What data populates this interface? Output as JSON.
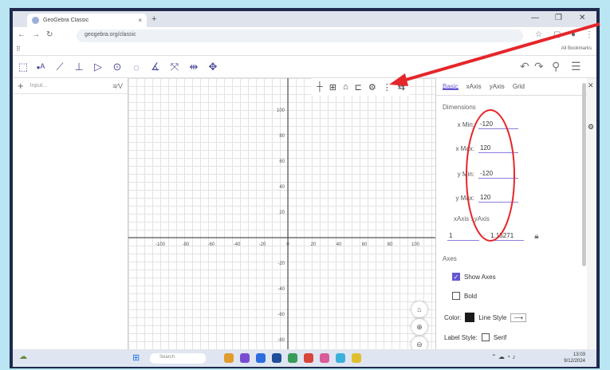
{
  "browser": {
    "tab_title": "GeoGebra Classic",
    "tab_close": "×",
    "new_tab": "+",
    "url": "geogebra.org/classic",
    "all_bookmarks": "All Bookmarks"
  },
  "algebra": {
    "add": "+",
    "input_placeholder": "Input..."
  },
  "graphics": {
    "x_ticks": [
      "-100",
      "-80",
      "-60",
      "-40",
      "-20",
      "0",
      "20",
      "40",
      "60",
      "80",
      "100"
    ],
    "y_ticks": [
      "100",
      "80",
      "60",
      "40",
      "20",
      "-20",
      "-40",
      "-60",
      "-80",
      "-100"
    ]
  },
  "settings": {
    "tabs": [
      "Basic",
      "xAxis",
      "yAxis",
      "Grid"
    ],
    "dimensions_label": "Dimensions",
    "xmin_label": "x Min:",
    "xmin_value": "-120",
    "xmax_label": "x Max:",
    "xmax_value": "120",
    "ymin_label": "y Min:",
    "ymin_value": "-120",
    "ymax_label": "y Max:",
    "ymax_value": "120",
    "ratio_label": "xAxis : yAxis",
    "ratio_x": "1",
    "ratio_sep": ":",
    "ratio_y": "1.15271",
    "axes_label": "Axes",
    "show_axes": "Show Axes",
    "bold": "Bold",
    "color_label": "Color:",
    "line_style_label": "Line Style",
    "label_style_label": "Label Style:",
    "label_style_bold": "Serif"
  },
  "taskbar": {
    "search_placeholder": "Search",
    "time": "13:03",
    "date": "9/12/2024"
  },
  "colors": {
    "accent": "#6557d2",
    "annotation": "#e5262a",
    "background": "#b9e6f2"
  }
}
